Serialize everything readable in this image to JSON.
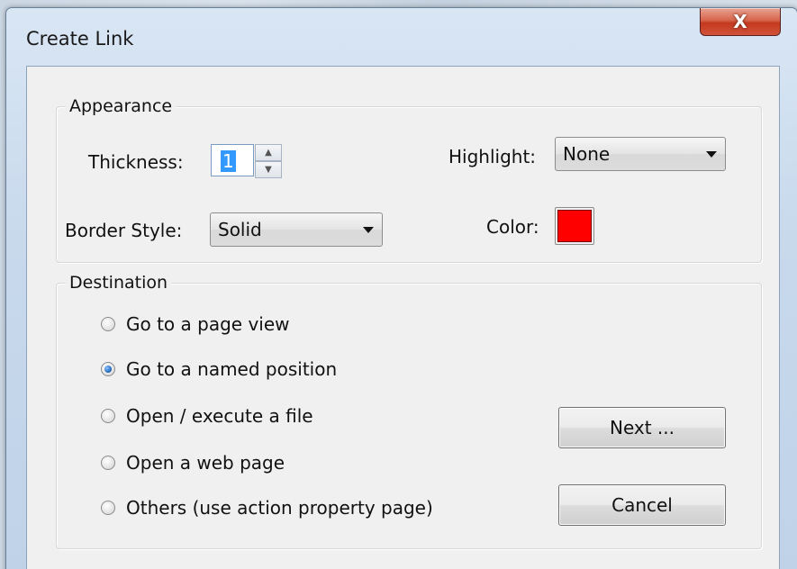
{
  "window": {
    "title": "Create Link",
    "close_glyph": "X"
  },
  "appearance": {
    "legend": "Appearance",
    "thickness_label": "Thickness:",
    "thickness_value": "1",
    "highlight_label": "Highlight:",
    "highlight_value": "None",
    "border_style_label": "Border Style:",
    "border_style_value": "Solid",
    "color_label": "Color:",
    "color_value": "#ff0000"
  },
  "destination": {
    "legend": "Destination",
    "options": [
      {
        "label": "Go to a page view",
        "checked": false
      },
      {
        "label": "Go to a named position",
        "checked": true
      },
      {
        "label": "Open / execute a file",
        "checked": false
      },
      {
        "label": "Open a web page",
        "checked": false
      },
      {
        "label": "Others (use action property page)",
        "checked": false
      }
    ]
  },
  "buttons": {
    "next_label": "Next ...",
    "cancel_label": "Cancel"
  },
  "icons": {
    "close": "close-icon",
    "spin_up": "spin-up-icon",
    "spin_down": "spin-down-icon",
    "dropdown": "chevron-down-icon"
  }
}
